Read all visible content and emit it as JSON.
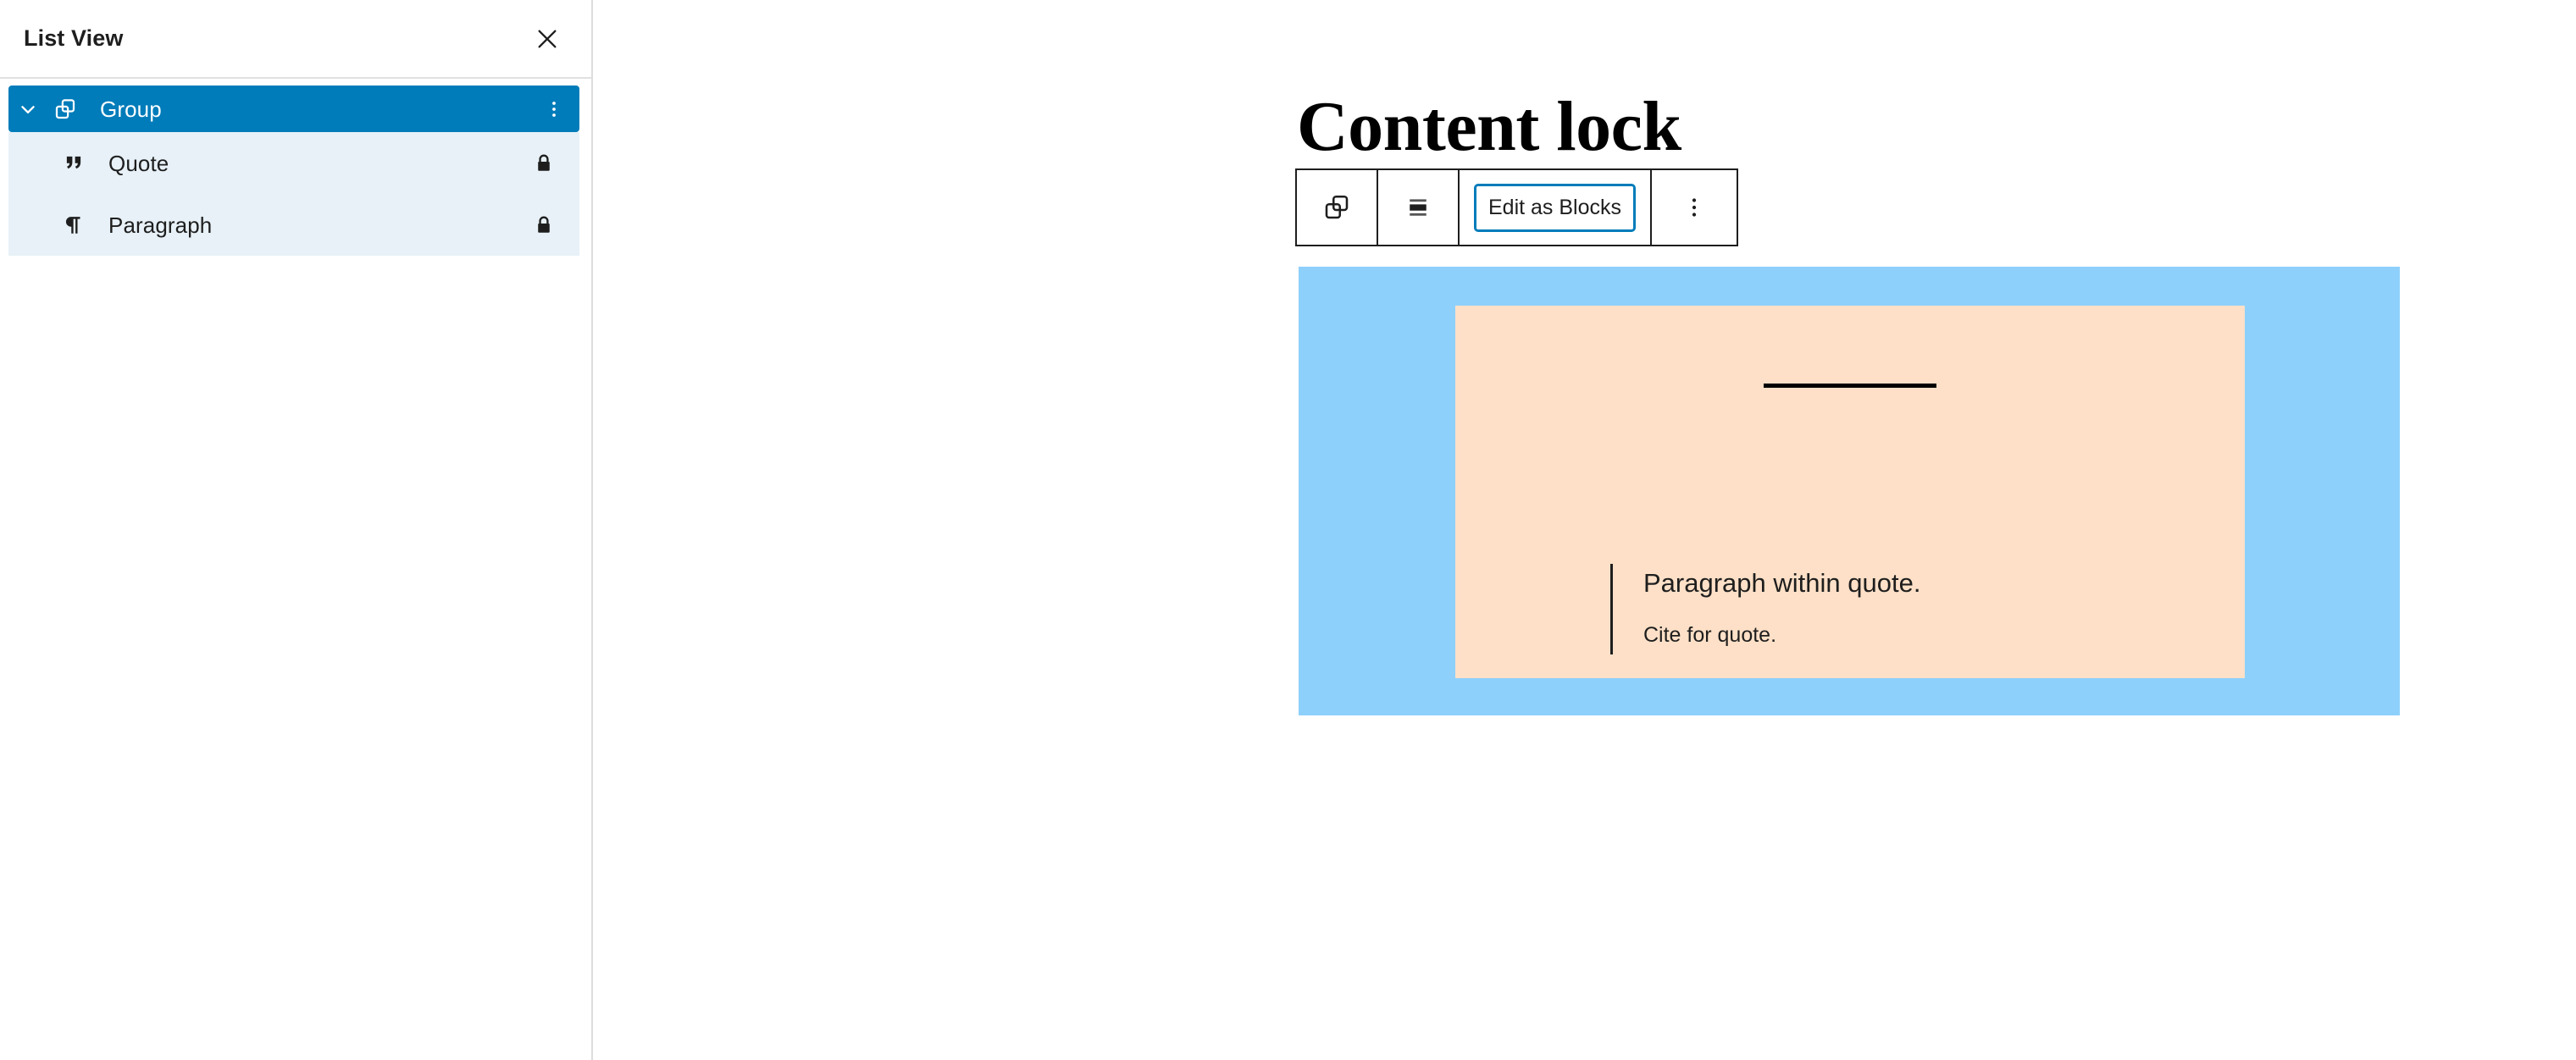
{
  "sidebar": {
    "title": "List View",
    "close_icon": "close-icon",
    "items": [
      {
        "label": "Group",
        "icon": "group-block-icon",
        "selected": true,
        "expanded": true,
        "locked": false,
        "has_options_menu": true,
        "options_icon": "kebab-menu-icon",
        "chevron_icon": "chevron-down-icon",
        "depth": 0
      },
      {
        "label": "Quote",
        "icon": "quote-block-icon",
        "selected": false,
        "locked": true,
        "lock_icon": "lock-closed-icon",
        "has_options_menu": false,
        "depth": 1
      },
      {
        "label": "Paragraph",
        "icon": "paragraph-pilcrow-icon",
        "selected": false,
        "locked": true,
        "lock_icon": "lock-closed-icon",
        "has_options_menu": false,
        "depth": 1
      }
    ]
  },
  "editor": {
    "post_title": "Content lock",
    "toolbar": {
      "block_type_icon": "group-block-icon",
      "align_icon": "align-center-icon",
      "edit_as_blocks_label": "Edit as Blocks",
      "more_options_icon": "kebab-menu-icon"
    },
    "content": {
      "group_block": {
        "background_color": "#8ed0fc",
        "quote_block": {
          "background_color": "#fde0c7",
          "paragraph": "Paragraph within quote.",
          "cite": "Cite for quote."
        }
      }
    }
  },
  "colors": {
    "accent": "#007cba",
    "selected_row_bg": "#007cba",
    "child_row_bg": "#e7f1f7",
    "group_bg": "#8ed0fc",
    "quote_bg": "#fde0c7",
    "text": "#1e1e1e"
  }
}
